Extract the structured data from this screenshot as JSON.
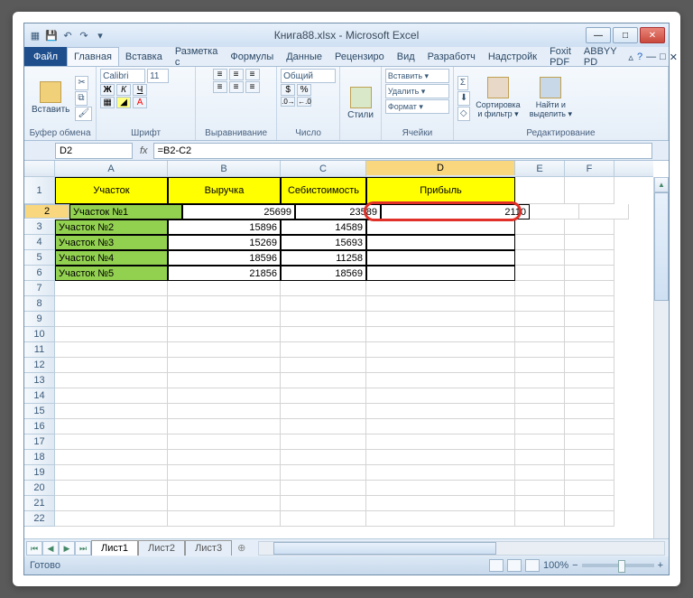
{
  "title": "Книга88.xlsx - Microsoft Excel",
  "file_tab": "Файл",
  "ribbon_tabs": [
    "Главная",
    "Вставка",
    "Разметка с",
    "Формулы",
    "Данные",
    "Рецензиро",
    "Вид",
    "Разработч",
    "Надстройк",
    "Foxit PDF",
    "ABBYY PD"
  ],
  "active_tab": 0,
  "ribbon": {
    "clipboard": {
      "paste": "Вставить",
      "label": "Буфер обмена"
    },
    "font": {
      "name": "Calibri",
      "size": "11",
      "label": "Шрифт"
    },
    "align": {
      "label": "Выравнивание"
    },
    "number": {
      "format": "Общий",
      "label": "Число"
    },
    "styles": {
      "btn": "Стили",
      "label": ""
    },
    "cells": {
      "insert": "Вставить ▾",
      "delete": "Удалить ▾",
      "format": "Формат ▾",
      "label": "Ячейки"
    },
    "editing": {
      "sort": "Сортировка\nи фильтр ▾",
      "find": "Найти и\nвыделить ▾",
      "label": "Редактирование"
    }
  },
  "namebox": "D2",
  "formula": "=B2-C2",
  "columns": [
    "A",
    "B",
    "C",
    "D",
    "E",
    "F"
  ],
  "selected_col": "D",
  "selected_row": 2,
  "headers": {
    "A": "Участок",
    "B": "Выручка",
    "C": "Себистоимость",
    "D": "Прибыль"
  },
  "rows": [
    {
      "A": "Участок №1",
      "B": "25699",
      "C": "23589",
      "D": "2110"
    },
    {
      "A": "Участок №2",
      "B": "15896",
      "C": "14589",
      "D": ""
    },
    {
      "A": "Участок №3",
      "B": "15269",
      "C": "15693",
      "D": ""
    },
    {
      "A": "Участок №4",
      "B": "18596",
      "C": "11258",
      "D": ""
    },
    {
      "A": "Участок №5",
      "B": "21856",
      "C": "18569",
      "D": ""
    }
  ],
  "sheets": [
    "Лист1",
    "Лист2",
    "Лист3"
  ],
  "active_sheet": 0,
  "status": "Готово",
  "zoom": "100%"
}
